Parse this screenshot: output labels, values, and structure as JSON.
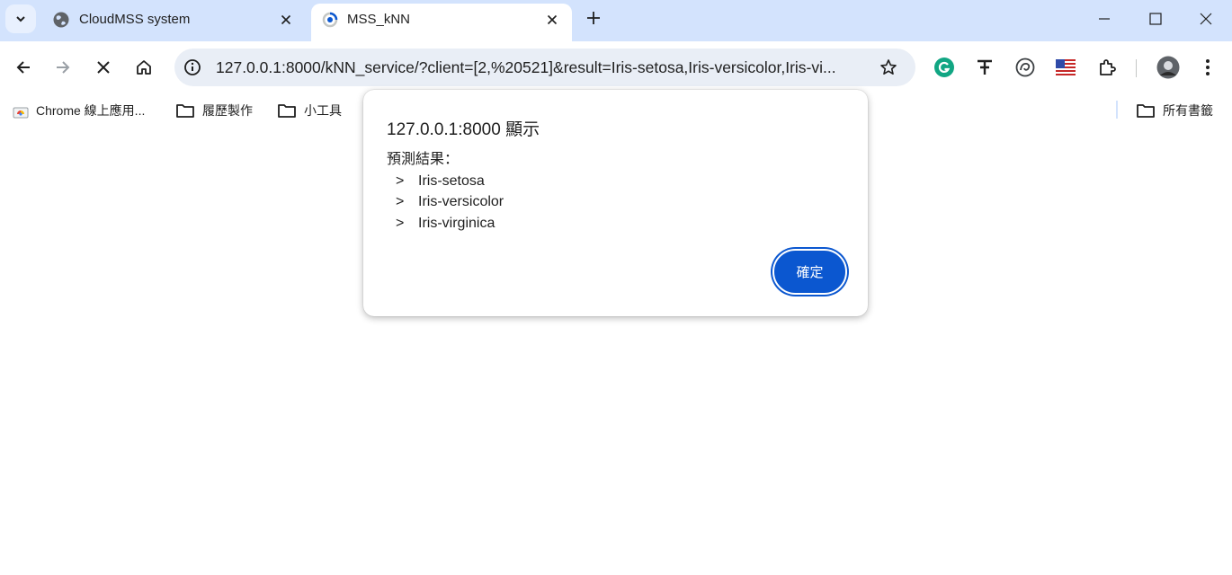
{
  "tabs": [
    {
      "title": "CloudMSS system",
      "active": false,
      "favicon": "globe-icon"
    },
    {
      "title": "MSS_kNN",
      "active": true,
      "favicon": "loading-spinner-icon"
    }
  ],
  "toolbar": {
    "url": "127.0.0.1:8000/kNN_service/?client=[2,%20521]&result=Iris-setosa,Iris-versicolor,Iris-vi..."
  },
  "bookmarks": {
    "items": [
      "Chrome 線上應用...",
      "履歷製作",
      "小工具"
    ],
    "all_bookmarks": "所有書籤"
  },
  "dialog": {
    "title": "127.0.0.1:8000 顯示",
    "heading": "預測結果：",
    "bullet": ">",
    "results": [
      "Iris-setosa",
      "Iris-versicolor",
      "Iris-virginica"
    ],
    "ok_label": "確定"
  },
  "colors": {
    "tabstrip_bg": "#d3e3fd",
    "omnibox_bg": "#e9eef6",
    "accent": "#0b57d0"
  }
}
